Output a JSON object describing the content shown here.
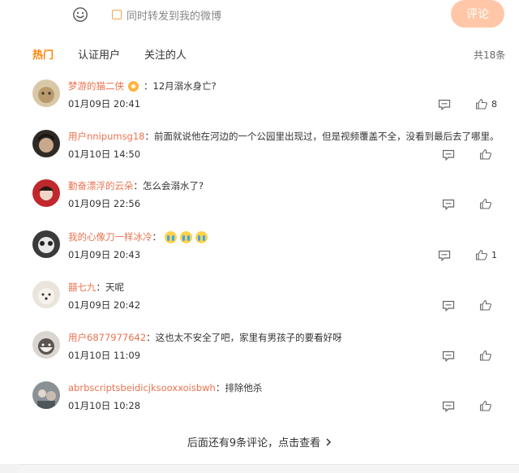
{
  "composer": {
    "emoji_icon": "smiley-icon",
    "repost_label": "同时转发到我的微博",
    "submit_label": "评论",
    "submit_color": "#ffc7a8"
  },
  "tabs": [
    {
      "label": "热门",
      "active": true
    },
    {
      "label": "认证用户",
      "active": false
    },
    {
      "label": "关注的人",
      "active": false
    }
  ],
  "total_label": "共18条",
  "comments": [
    {
      "user": "梦游的猫二侠",
      "badge": true,
      "separator": "：",
      "text": "12月溺水身亡?",
      "time": "01月09日 20:41",
      "likes": "8"
    },
    {
      "user": "用户nnipumsg18",
      "badge": false,
      "separator": "：",
      "text": "前面就说他在河边的一个公园里出现过，但是视频覆盖不全，没看到最后去了哪里。",
      "time": "01月10日 14:50",
      "likes": ""
    },
    {
      "user": "勤奋漂浮的云朵",
      "badge": false,
      "separator": "：",
      "text": "怎么会溺水了?",
      "time": "01月09日 22:56",
      "likes": ""
    },
    {
      "user": "我的心像刀一样冰冷",
      "badge": false,
      "separator": "：",
      "text": "",
      "emojis": 3,
      "time": "01月09日 20:43",
      "likes": "1"
    },
    {
      "user": "囍七九",
      "badge": false,
      "separator": "：",
      "text": "天呢",
      "time": "01月09日 20:42",
      "likes": ""
    },
    {
      "user": "用户6877977642",
      "badge": false,
      "separator": "：",
      "text": "这也太不安全了吧，家里有男孩子的要看好呀",
      "time": "01月10日 11:09",
      "likes": ""
    },
    {
      "user": "abrbscriptsbeidicjksooxxoisbwh",
      "badge": false,
      "separator": "：",
      "text": "排除他杀",
      "time": "01月10日 10:28",
      "likes": ""
    }
  ],
  "more_label": "后面还有9条评论，点击查看",
  "accent_color": "#ff8200",
  "username_color": "#eb7350"
}
